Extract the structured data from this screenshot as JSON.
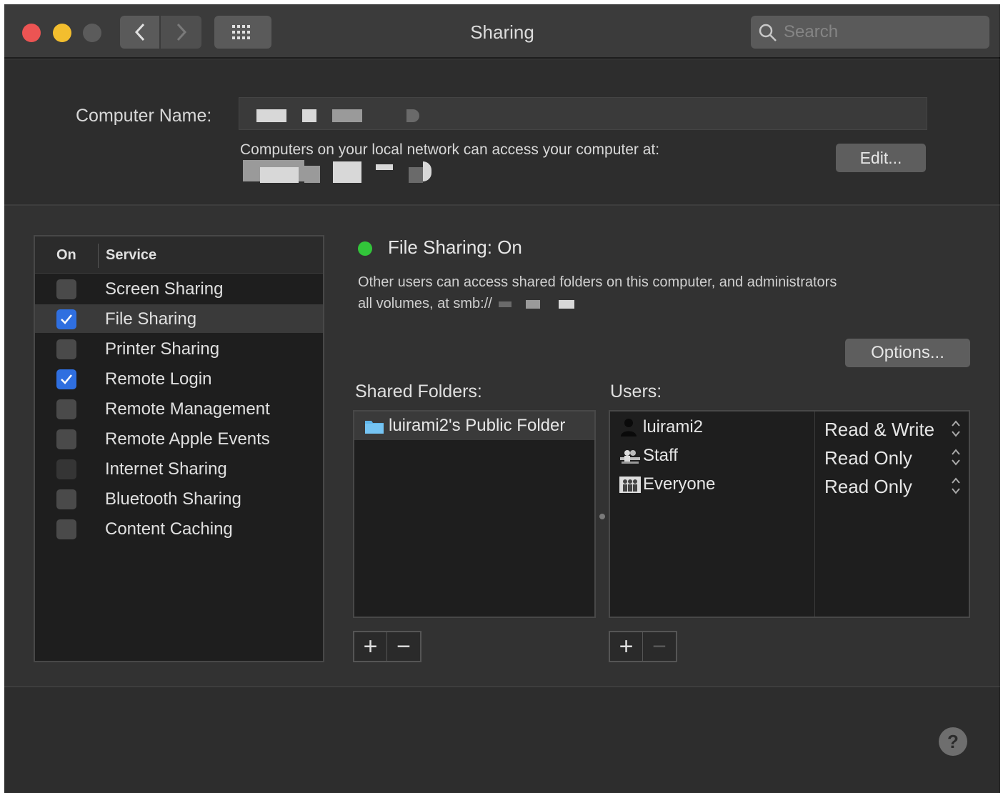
{
  "window": {
    "title": "Sharing"
  },
  "search": {
    "placeholder": "Search"
  },
  "computer": {
    "name_label": "Computer Name:",
    "network_text": "Computers on your local network can access your computer at:",
    "edit_label": "Edit..."
  },
  "services": {
    "header_on": "On",
    "header_service": "Service",
    "items": [
      {
        "label": "Screen Sharing",
        "checked": false
      },
      {
        "label": "File Sharing",
        "checked": true,
        "selected": true
      },
      {
        "label": "Printer Sharing",
        "checked": false
      },
      {
        "label": "Remote Login",
        "checked": true
      },
      {
        "label": "Remote Management",
        "checked": false
      },
      {
        "label": "Remote Apple Events",
        "checked": false
      },
      {
        "label": "Internet Sharing",
        "checked": false,
        "disabled": true
      },
      {
        "label": "Bluetooth Sharing",
        "checked": false
      },
      {
        "label": "Content Caching",
        "checked": false
      }
    ]
  },
  "file_sharing": {
    "status": "File Sharing: On",
    "status_color": "#32c53a",
    "description_line1": "Other users can access shared folders on this computer, and administrators",
    "description_line2": "all volumes, at smb://",
    "options_label": "Options..."
  },
  "shared_folders": {
    "label": "Shared Folders:",
    "items": [
      {
        "name": "luirami2's Public Folder",
        "icon": "folder-icon"
      }
    ]
  },
  "users": {
    "label": "Users:",
    "items": [
      {
        "name": "luirami2",
        "permission": "Read & Write",
        "icon": "user-icon"
      },
      {
        "name": "Staff",
        "permission": "Read Only",
        "icon": "group-icon"
      },
      {
        "name": "Everyone",
        "permission": "Read Only",
        "icon": "everyone-icon"
      }
    ]
  },
  "controls": {
    "add": "+",
    "remove": "−",
    "help": "?"
  },
  "colors": {
    "accent": "#2f6fe0",
    "close": "#ec5453",
    "minimize": "#f3be2e"
  }
}
